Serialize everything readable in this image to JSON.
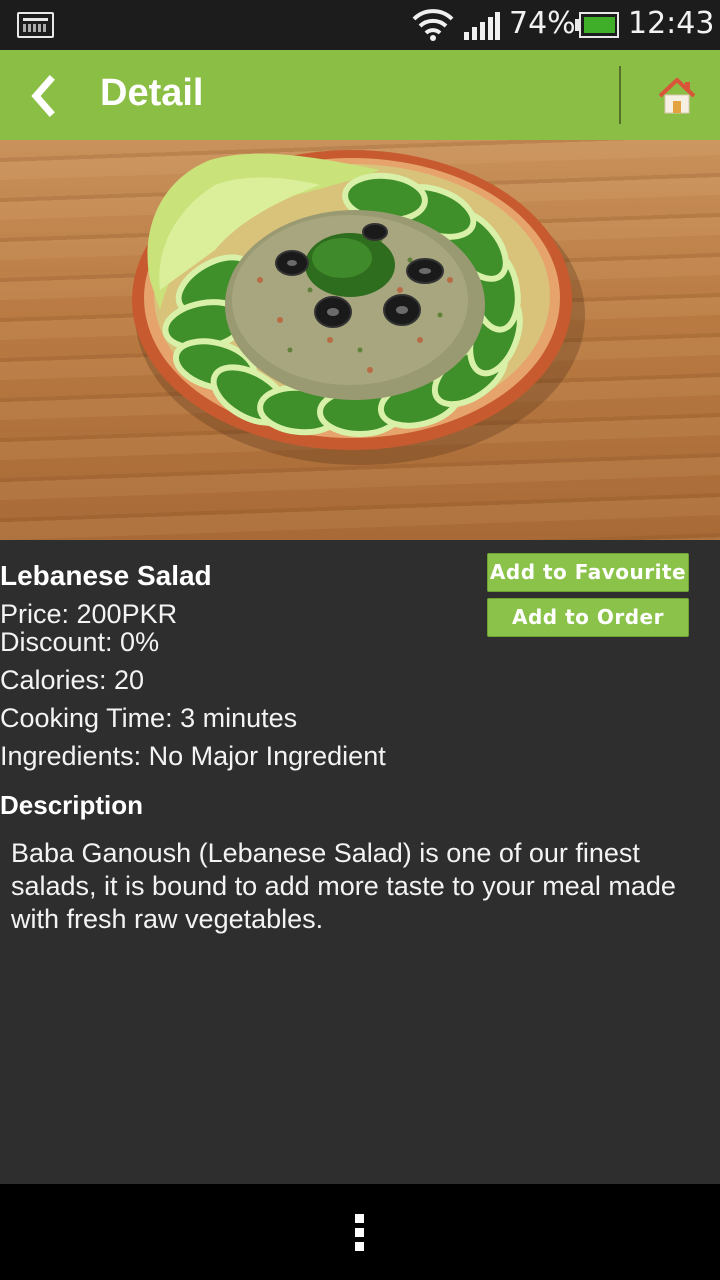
{
  "status_bar": {
    "notification_icon": "notification-image-icon",
    "wifi_icon": "wifi-icon",
    "signal_icon": "signal-icon",
    "battery_percent": "74%",
    "battery_icon": "battery-icon",
    "time": "12:43"
  },
  "action_bar": {
    "title": "Detail",
    "back_icon": "chevron-left-icon",
    "home_icon": "home-icon",
    "color": "#8bbe44"
  },
  "item": {
    "name": "Lebanese Salad",
    "price": "Price: 200PKR",
    "discount": "Discount: 0%",
    "calories": "Calories: 20",
    "cooking_time": "Cooking Time: 3 minutes",
    "ingredients": "Ingredients: No Major Ingredient",
    "description_title": "Description",
    "description": "Baba Ganoush (Lebanese Salad) is one of our finest salads, it is bound to add more taste to your meal made with fresh raw vegetables."
  },
  "buttons": {
    "add_favourite": "Add to Favourite",
    "add_order": "Add to Order",
    "color": "#8bc34a"
  },
  "nav_bar": {
    "menu_icon": "overflow-menu-icon"
  }
}
